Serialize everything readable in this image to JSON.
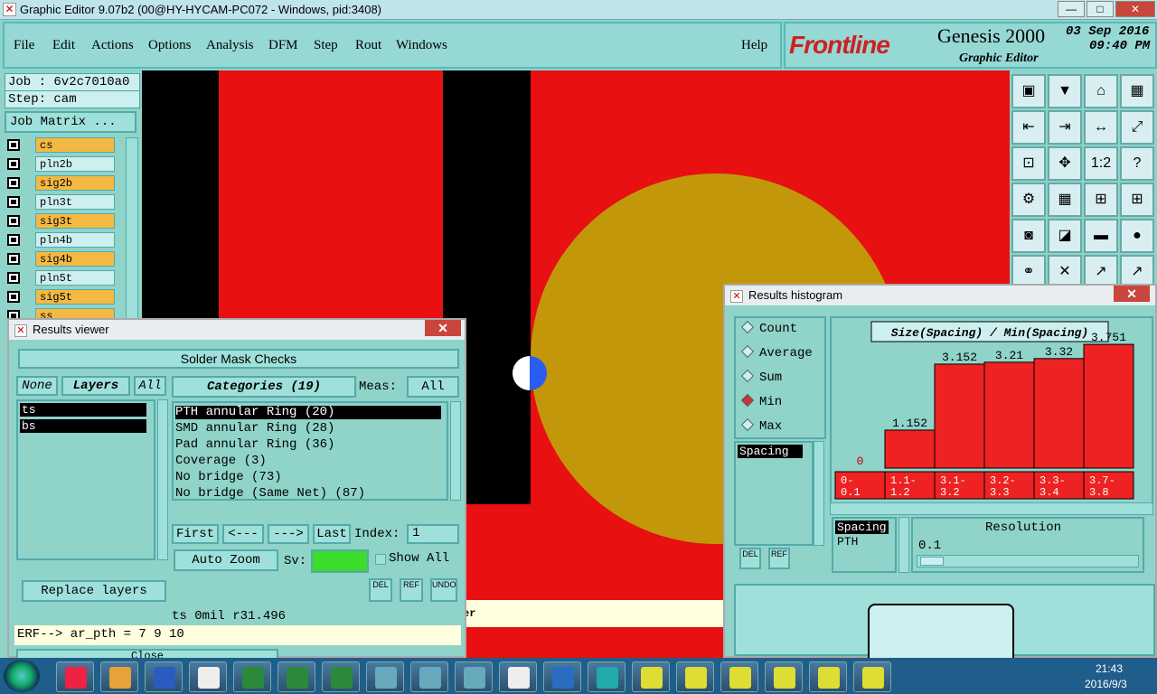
{
  "window": {
    "title": "Graphic Editor 9.07b2 (00@HY-HYCAM-PC072 - Windows, pid:3408)",
    "min": "—",
    "max": "□",
    "close": "✕"
  },
  "menu": {
    "items": [
      "File",
      "Edit",
      "Actions",
      "Options",
      "Analysis",
      "DFM",
      "Step",
      "Rout",
      "Windows"
    ],
    "help": "Help"
  },
  "brand": {
    "logo": "Frontline",
    "product": "Genesis 2000",
    "subtitle": "Graphic Editor",
    "date": "03 Sep 2016",
    "time": "09:40 PM"
  },
  "job": {
    "job": "Job : 6v2c7010a0",
    "step": "Step: cam",
    "matrix_btn": "Job Matrix ..."
  },
  "layers": [
    {
      "name": "cs",
      "color": "#f4b942"
    },
    {
      "name": "pln2b",
      "color": "#cdeff0"
    },
    {
      "name": "sig2b",
      "color": "#f4b942"
    },
    {
      "name": "pln3t",
      "color": "#cdeff0"
    },
    {
      "name": "sig3t",
      "color": "#f4b942"
    },
    {
      "name": "pln4b",
      "color": "#cdeff0"
    },
    {
      "name": "sig4b",
      "color": "#f4b942"
    },
    {
      "name": "pln5t",
      "color": "#cdeff0"
    },
    {
      "name": "sig5t",
      "color": "#f4b942"
    },
    {
      "name": "ss",
      "color": "#f4b942"
    }
  ],
  "results_viewer": {
    "title": "Results viewer",
    "close": "✕",
    "header": "Solder Mask Checks",
    "none": "None",
    "layers": "Layers",
    "all": "All",
    "layer_items": [
      "ts",
      "bs"
    ],
    "categories_label": "Categories (19)",
    "meas_label": "Meas:",
    "meas_value": "All",
    "categories": [
      "PTH annular Ring (20)",
      "SMD annular Ring (28)",
      "Pad annular Ring (36)",
      "Coverage (3)",
      "No bridge (73)",
      "No bridge (Same Net) (87)"
    ],
    "first": "First",
    "prev": "<---",
    "next": "--->",
    "last": "Last",
    "index_label": "Index:",
    "index_value": "1",
    "auto_zoom": "Auto Zoom",
    "sv_label": "Sv:",
    "show_all": "Show All",
    "replace_layers": "Replace layers",
    "del": "DEL",
    "ref": "REF",
    "undo": "UNDO",
    "status": "ts 0mil   r31.496",
    "erf": "ERF--> ar_pth = 7 9 10",
    "close_btn": "Close",
    "er": "er"
  },
  "histogram": {
    "title": "Results histogram",
    "close": "✕",
    "modes": [
      "Count",
      "Average",
      "Sum",
      "Min",
      "Max"
    ],
    "selected_mode": "Min",
    "chart_title": "Size(Spacing) / Min(Spacing)",
    "list_item": "Spacing",
    "del": "DEL",
    "ref": "REF",
    "list2": [
      "Spacing",
      "PTH"
    ],
    "resolution_label": "Resolution",
    "resolution_value": "0.1"
  },
  "chart_data": {
    "type": "bar",
    "categories": [
      "0-\n0.1",
      "1.1-\n1.2",
      "3.1-\n3.2",
      "3.2-\n3.3",
      "3.3-\n3.4",
      "3.7-\n3.8"
    ],
    "values": [
      0,
      1.152,
      3.152,
      3.21,
      3.32,
      3.751
    ],
    "value_labels": [
      "0",
      "1.152",
      "3.152",
      "3.21",
      "3.32",
      "3.751"
    ],
    "title": "Size(Spacing) / Min(Spacing)",
    "ylim": [
      0,
      4
    ],
    "bar_color": "#ee2222"
  },
  "clock": {
    "time": "21:43",
    "date": "2016/9/3"
  }
}
